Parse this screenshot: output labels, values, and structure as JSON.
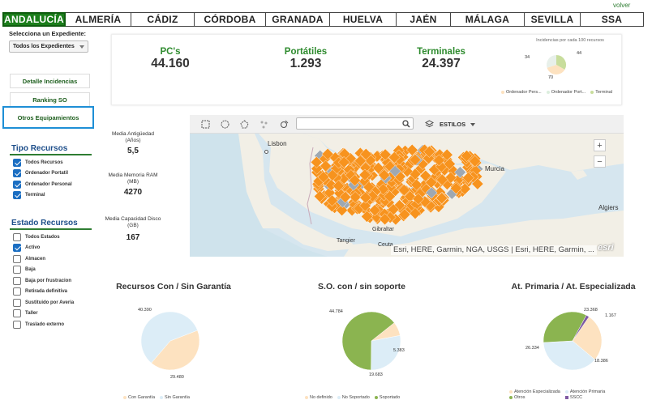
{
  "header": {
    "volver": "volver"
  },
  "tabs": [
    {
      "label": "ANDALUCÍA",
      "active": true
    },
    {
      "label": "ALMERÍA"
    },
    {
      "label": "CÁDIZ"
    },
    {
      "label": "CÓRDOBA"
    },
    {
      "label": "GRANADA"
    },
    {
      "label": "HUELVA"
    },
    {
      "label": "JAÉN"
    },
    {
      "label": "MÁLAGA"
    },
    {
      "label": "SEVILLA"
    },
    {
      "label": "SSA"
    }
  ],
  "sidebar": {
    "select_label": "Selecciona un Expediente:",
    "select_value": "Todos los Expedientes",
    "nav": [
      "Detalle Incidencias",
      "Ranking SO",
      "Otros Equipamientos"
    ],
    "tipo_title": "Tipo Recursos",
    "tipo": [
      {
        "label": "Todos Recursos",
        "checked": true
      },
      {
        "label": "Ordenador Portatil",
        "checked": true
      },
      {
        "label": "Ordenador Personal",
        "checked": true
      },
      {
        "label": "Terminal",
        "checked": true
      }
    ],
    "estado_title": "Estado Recursos",
    "estado": [
      {
        "label": "Todos Estados",
        "checked": false
      },
      {
        "label": "Activo",
        "checked": true
      },
      {
        "label": "Almacen",
        "checked": false
      },
      {
        "label": "Baja",
        "checked": false
      },
      {
        "label": "Baja por frustracion",
        "checked": false
      },
      {
        "label": "Retirada definitiva",
        "checked": false
      },
      {
        "label": "Sustituido por Averia",
        "checked": false
      },
      {
        "label": "Taller",
        "checked": false
      },
      {
        "label": "Traslado externo",
        "checked": false
      }
    ]
  },
  "kpis": [
    {
      "title": "PC's",
      "value": "44.160"
    },
    {
      "title": "Portátiles",
      "value": "1.293"
    },
    {
      "title": "Terminales",
      "value": "24.397"
    }
  ],
  "mini_chart": {
    "title": "Incidencias por cada 100 recursos",
    "labels": [
      "34",
      "44",
      "70"
    ],
    "legend": [
      "Ordenador Pers...",
      "Ordenador Port...",
      "Terminal"
    ],
    "colors": [
      "#fde2c0",
      "#dceede",
      "#c8dd9c"
    ]
  },
  "stats": [
    {
      "label1": "Media Antigüedad",
      "label2": "(Años)",
      "value": "5,5"
    },
    {
      "label1": "Media Memoria RAM",
      "label2": "(MB)",
      "value": "4270"
    },
    {
      "label1": "Media Capacidad Disco",
      "label2": "(GB)",
      "value": "167"
    }
  ],
  "map": {
    "estilos": "ESTILOS",
    "cities": [
      "Lisbon",
      "Murcia",
      "Algiers",
      "Gibraltar",
      "Tangier",
      "Ceuta"
    ],
    "attribution": "Esri, HERE, Garmin, NGA, USGS | Esri, HERE, Garmin, ...",
    "logo": "esri",
    "marker_color": "#f7931e"
  },
  "chart_data": [
    {
      "type": "pie",
      "title": "Recursos Con / Sin Garantía",
      "categories": [
        "Con Garantía",
        "Sin Garantía"
      ],
      "values": [
        29480,
        40390
      ],
      "value_labels": [
        "29.480",
        "40.390"
      ],
      "colors": [
        "#fde2c0",
        "#dcedf7"
      ]
    },
    {
      "type": "pie",
      "title": "S.O. con / sin soporte",
      "categories": [
        "No definido",
        "No Soportado",
        "Soportado"
      ],
      "values": [
        5383,
        19683,
        44784
      ],
      "value_labels": [
        "5.383",
        "19.683",
        "44.784"
      ],
      "colors": [
        "#fde2c0",
        "#dcedf7",
        "#8bb450"
      ]
    },
    {
      "type": "pie",
      "title": "At. Primaria / At. Especializada",
      "categories": [
        "Atención Especializada",
        "Atención Primaria",
        "Otros",
        "SSCC"
      ],
      "values": [
        18386,
        26334,
        23368,
        1167
      ],
      "value_labels": [
        "18.386",
        "26.334",
        "23.368",
        "1.167"
      ],
      "colors": [
        "#fde2c0",
        "#dcedf7",
        "#8bb450",
        "#7f5aa3"
      ]
    }
  ]
}
